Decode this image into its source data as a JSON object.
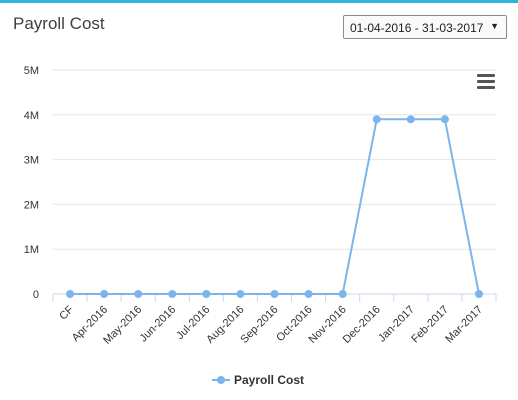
{
  "widget": {
    "title": "Payroll Cost",
    "date_range": "01-04-2016 - 31-03-2017",
    "menu_icon": "hamburger-menu-icon"
  },
  "colors": {
    "accent_border": "#2bb8d6",
    "series": "#7cb5ec"
  },
  "chart_data": {
    "type": "line",
    "categories": [
      "CF",
      "Apr-2016",
      "May-2016",
      "Jun-2016",
      "Jul-2016",
      "Aug-2016",
      "Sep-2016",
      "Oct-2016",
      "Nov-2016",
      "Dec-2016",
      "Jan-2017",
      "Feb-2017",
      "Mar-2017"
    ],
    "series": [
      {
        "name": "Payroll Cost",
        "values": [
          0,
          0,
          0,
          0,
          0,
          0,
          0,
          0,
          0,
          3900000,
          3900000,
          3900000,
          0
        ]
      }
    ],
    "y_ticks": [
      "0",
      "1M",
      "2M",
      "3M",
      "4M",
      "5M"
    ],
    "ylim": [
      0,
      5000000
    ],
    "grid": true,
    "legend_position": "bottom-center"
  }
}
